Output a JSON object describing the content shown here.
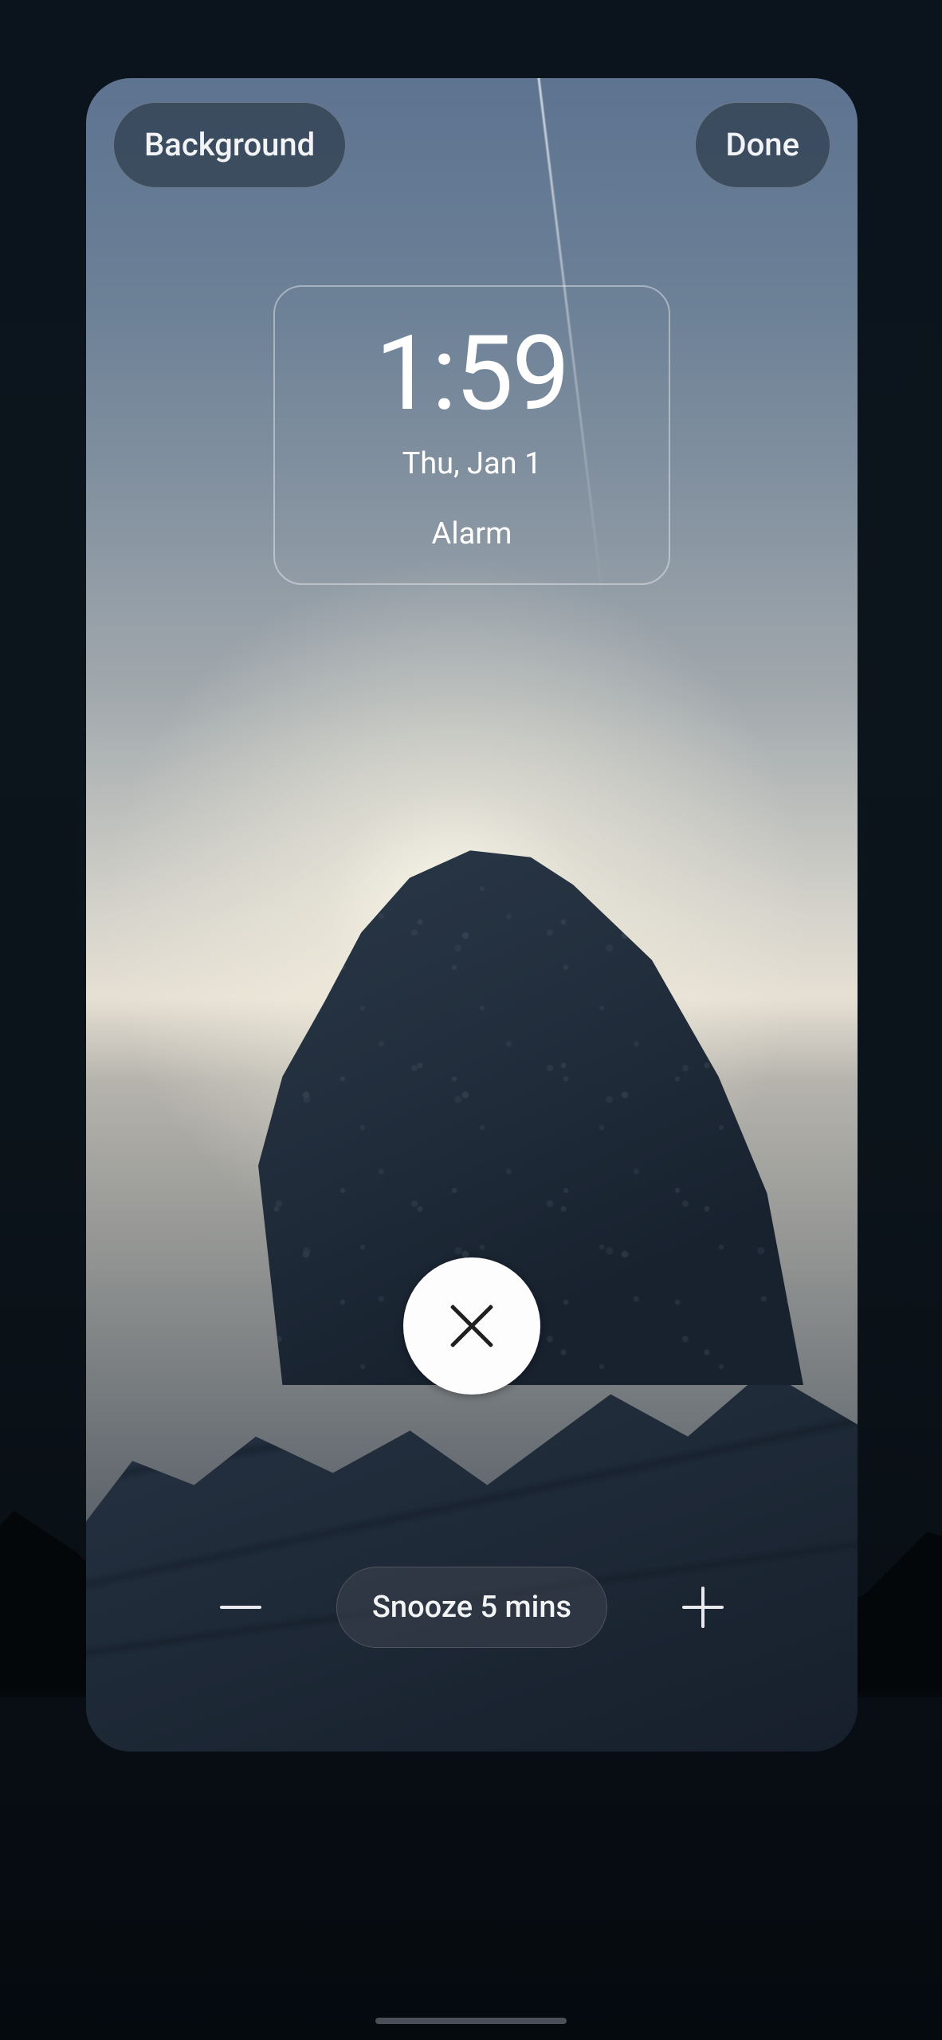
{
  "toolbar": {
    "background_label": "Background",
    "done_label": "Done"
  },
  "clock": {
    "time": "1:59",
    "date": "Thu, Jan 1",
    "label": "Alarm"
  },
  "dismiss": {
    "icon_name": "close-icon"
  },
  "snooze": {
    "minus_icon": "minus-icon",
    "plus_icon": "plus-icon",
    "chip_label": "Snooze 5 mins"
  }
}
